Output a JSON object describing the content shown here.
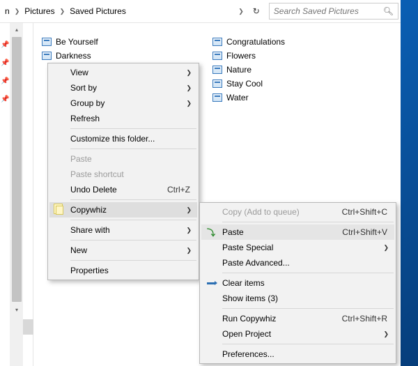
{
  "breadcrumb": {
    "seg0_suffix": "n",
    "seg1": "Pictures",
    "seg2": "Saved Pictures"
  },
  "search": {
    "placeholder": "Search Saved Pictures"
  },
  "files_left": [
    {
      "name": "Be Yourself"
    },
    {
      "name": "Darkness"
    }
  ],
  "files_right": [
    {
      "name": "Congratulations"
    },
    {
      "name": "Flowers"
    },
    {
      "name": "Nature"
    },
    {
      "name": "Stay Cool"
    },
    {
      "name": "Water"
    }
  ],
  "ctx1": {
    "view": "View",
    "sortby": "Sort by",
    "groupby": "Group by",
    "refresh": "Refresh",
    "customize": "Customize this folder...",
    "paste": "Paste",
    "paste_shortcut": "Paste shortcut",
    "undo": "Undo Delete",
    "undo_sc": "Ctrl+Z",
    "copywhiz": "Copywhiz",
    "sharewith": "Share with",
    "new": "New",
    "properties": "Properties"
  },
  "ctx2": {
    "copy": "Copy (Add to queue)",
    "copy_sc": "Ctrl+Shift+C",
    "paste": "Paste",
    "paste_sc": "Ctrl+Shift+V",
    "paste_special": "Paste Special",
    "paste_advanced": "Paste Advanced...",
    "clear": "Clear items",
    "show": "Show items (3)",
    "run": "Run Copywhiz",
    "run_sc": "Ctrl+Shift+R",
    "open_project": "Open Project",
    "prefs": "Preferences..."
  }
}
